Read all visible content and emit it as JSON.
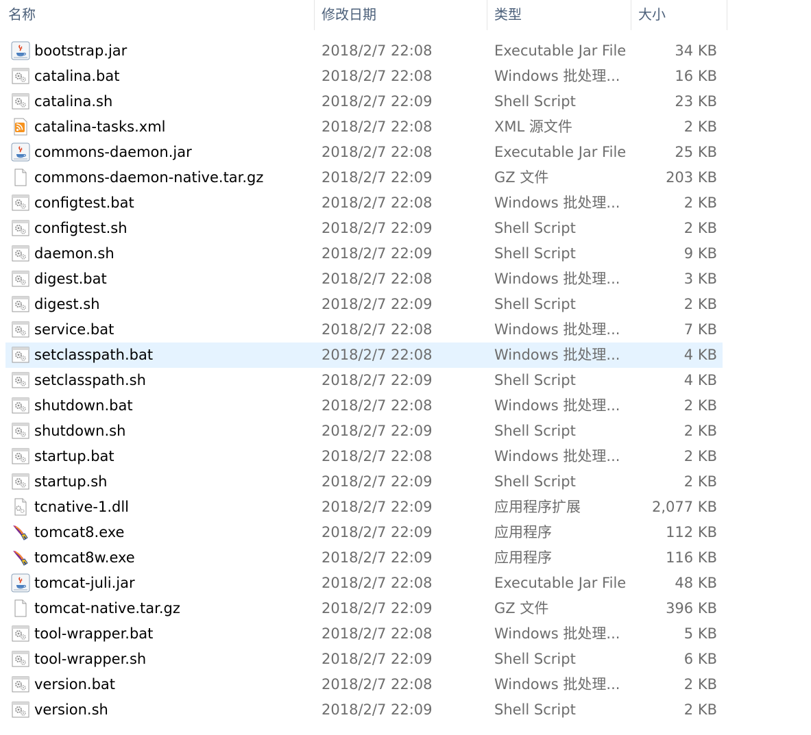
{
  "columns": {
    "name": "名称",
    "date": "修改日期",
    "type": "类型",
    "size": "大小"
  },
  "sort_indicator": "^",
  "selected_index": 12,
  "files": [
    {
      "name": "bootstrap.jar",
      "date": "2018/2/7 22:08",
      "type": "Executable Jar File",
      "size": "34 KB",
      "icon": "java-jar-icon"
    },
    {
      "name": "catalina.bat",
      "date": "2018/2/7 22:08",
      "type": "Windows 批处理...",
      "size": "16 KB",
      "icon": "batch-file-icon"
    },
    {
      "name": "catalina.sh",
      "date": "2018/2/7 22:09",
      "type": "Shell Script",
      "size": "23 KB",
      "icon": "batch-file-icon"
    },
    {
      "name": "catalina-tasks.xml",
      "date": "2018/2/7 22:08",
      "type": "XML 源文件",
      "size": "2 KB",
      "icon": "xml-rss-icon"
    },
    {
      "name": "commons-daemon.jar",
      "date": "2018/2/7 22:08",
      "type": "Executable Jar File",
      "size": "25 KB",
      "icon": "java-jar-icon"
    },
    {
      "name": "commons-daemon-native.tar.gz",
      "date": "2018/2/7 22:09",
      "type": "GZ 文件",
      "size": "203 KB",
      "icon": "blank-file-icon"
    },
    {
      "name": "configtest.bat",
      "date": "2018/2/7 22:08",
      "type": "Windows 批处理...",
      "size": "2 KB",
      "icon": "batch-file-icon"
    },
    {
      "name": "configtest.sh",
      "date": "2018/2/7 22:09",
      "type": "Shell Script",
      "size": "2 KB",
      "icon": "batch-file-icon"
    },
    {
      "name": "daemon.sh",
      "date": "2018/2/7 22:09",
      "type": "Shell Script",
      "size": "9 KB",
      "icon": "batch-file-icon"
    },
    {
      "name": "digest.bat",
      "date": "2018/2/7 22:08",
      "type": "Windows 批处理...",
      "size": "3 KB",
      "icon": "batch-file-icon"
    },
    {
      "name": "digest.sh",
      "date": "2018/2/7 22:09",
      "type": "Shell Script",
      "size": "2 KB",
      "icon": "batch-file-icon"
    },
    {
      "name": "service.bat",
      "date": "2018/2/7 22:08",
      "type": "Windows 批处理...",
      "size": "7 KB",
      "icon": "batch-file-icon"
    },
    {
      "name": "setclasspath.bat",
      "date": "2018/2/7 22:08",
      "type": "Windows 批处理...",
      "size": "4 KB",
      "icon": "batch-file-icon"
    },
    {
      "name": "setclasspath.sh",
      "date": "2018/2/7 22:09",
      "type": "Shell Script",
      "size": "4 KB",
      "icon": "batch-file-icon"
    },
    {
      "name": "shutdown.bat",
      "date": "2018/2/7 22:08",
      "type": "Windows 批处理...",
      "size": "2 KB",
      "icon": "batch-file-icon"
    },
    {
      "name": "shutdown.sh",
      "date": "2018/2/7 22:09",
      "type": "Shell Script",
      "size": "2 KB",
      "icon": "batch-file-icon"
    },
    {
      "name": "startup.bat",
      "date": "2018/2/7 22:08",
      "type": "Windows 批处理...",
      "size": "2 KB",
      "icon": "batch-file-icon"
    },
    {
      "name": "startup.sh",
      "date": "2018/2/7 22:09",
      "type": "Shell Script",
      "size": "2 KB",
      "icon": "batch-file-icon"
    },
    {
      "name": "tcnative-1.dll",
      "date": "2018/2/7 22:09",
      "type": "应用程序扩展",
      "size": "2,077 KB",
      "icon": "dll-file-icon"
    },
    {
      "name": "tomcat8.exe",
      "date": "2018/2/7 22:09",
      "type": "应用程序",
      "size": "112 KB",
      "icon": "tomcat-feather-icon"
    },
    {
      "name": "tomcat8w.exe",
      "date": "2018/2/7 22:09",
      "type": "应用程序",
      "size": "116 KB",
      "icon": "tomcat-feather-icon"
    },
    {
      "name": "tomcat-juli.jar",
      "date": "2018/2/7 22:08",
      "type": "Executable Jar File",
      "size": "48 KB",
      "icon": "java-jar-icon"
    },
    {
      "name": "tomcat-native.tar.gz",
      "date": "2018/2/7 22:09",
      "type": "GZ 文件",
      "size": "396 KB",
      "icon": "blank-file-icon"
    },
    {
      "name": "tool-wrapper.bat",
      "date": "2018/2/7 22:08",
      "type": "Windows 批处理...",
      "size": "5 KB",
      "icon": "batch-file-icon"
    },
    {
      "name": "tool-wrapper.sh",
      "date": "2018/2/7 22:09",
      "type": "Shell Script",
      "size": "6 KB",
      "icon": "batch-file-icon"
    },
    {
      "name": "version.bat",
      "date": "2018/2/7 22:08",
      "type": "Windows 批处理...",
      "size": "2 KB",
      "icon": "batch-file-icon"
    },
    {
      "name": "version.sh",
      "date": "2018/2/7 22:09",
      "type": "Shell Script",
      "size": "2 KB",
      "icon": "batch-file-icon"
    }
  ],
  "colors": {
    "header_text": "#4c607a",
    "selection": "#e5f3ff",
    "secondary_text": "#6d6d6d",
    "rss_orange": "#f7931e",
    "java_blue": "#4a7fbf",
    "java_red": "#e2411c"
  }
}
